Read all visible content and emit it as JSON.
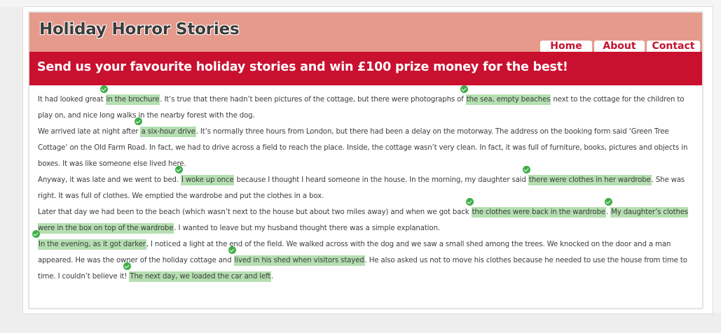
{
  "site": {
    "title": "Holiday Horror Stories",
    "nav": {
      "home": "Home",
      "about": "About",
      "contact": "Contact"
    },
    "promo": "Send us your favourite holiday stories and win £100 prize money for the best!"
  },
  "colors": {
    "banner": "#e59a8c",
    "redbar": "#c9102f",
    "nav_text": "#c41230",
    "answer_highlight": "#b5dfb1",
    "check": "#3fae49"
  },
  "story": {
    "p1": {
      "t1": "It had looked great ",
      "a1": "in the brochure",
      "t2": ". It’s true that there hadn’t been pictures of the cottage, but there were photographs of ",
      "a2": "the sea, empty beaches",
      "t3": " next to the cottage for the children to play on, and nice long walks in the nearby forest with the dog."
    },
    "p2": {
      "t1": "We arrived late at night after ",
      "a1": "a six-hour drive",
      "t2": ". It’s normally three hours from London, but there had been a delay on the motorway. The address on the booking form said ‘Green Tree Cottage’ on the Old Farm Road. In fact, we had to drive across a field to reach the place. Inside, the cottage wasn’t very clean. In fact, it was full of furniture, books, pictures and objects in boxes. It was like someone else lived here."
    },
    "p3": {
      "t1": "Anyway, it was late and we went to bed. ",
      "a1": "I woke up once",
      "t2": " because I thought I heard someone in the house. In the morning, my daughter said ",
      "a2": "there were clothes in her wardrobe",
      "t3": ". She was right. It was full of clothes. We emptied the wardrobe and put the clothes in a box."
    },
    "p4": {
      "t1": "Later that day we had been to the beach (which wasn’t next to the house but about two miles away) and when we got back ",
      "a1": "the clothes were back in the wardrobe",
      "t2": ". ",
      "a2": "My daughter’s clothes were in the box on top of the wardrobe",
      "t3": ". I wanted to leave but my husband thought there was a simple explanation."
    },
    "p5": {
      "a1": "In the evening, as it got darker",
      "t1": ", I noticed a light at the end of the field. We walked across with the dog and we saw a small shed among the trees. We knocked on the door and a man appeared. He was the owner of the holiday cottage and ",
      "a2": "lived in his shed when visitors stayed",
      "t2": ". He also asked us not to move his clothes because he needed to use the house from time to time. I couldn’t believe it! ",
      "a3": "The next day, we loaded the car and left",
      "t3": "."
    }
  }
}
